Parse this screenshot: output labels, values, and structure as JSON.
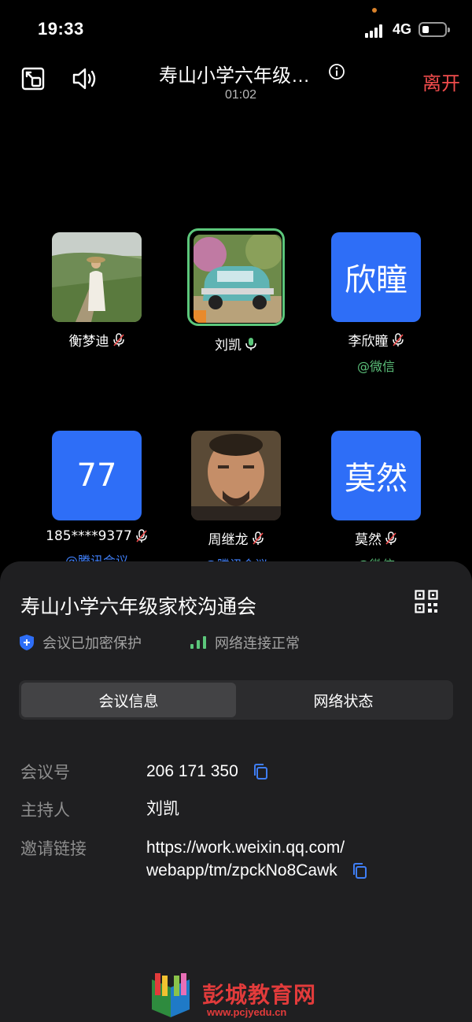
{
  "status_bar": {
    "time": "19:33",
    "network": "4G"
  },
  "header": {
    "title": "寿山小学六年级…",
    "elapsed": "01:02",
    "leave_label": "离开"
  },
  "participants": [
    {
      "name": "衡梦迪",
      "avatar_text": "",
      "source": "",
      "mic": "muted"
    },
    {
      "name": "刘凯",
      "avatar_text": "",
      "source": "",
      "mic": "on"
    },
    {
      "name": "李欣瞳",
      "avatar_text": "欣瞳",
      "source": "@微信",
      "mic": "muted"
    },
    {
      "name": "185****9377",
      "avatar_text": "77",
      "source": "@腾讯会议",
      "mic": "muted"
    },
    {
      "name": "周继龙",
      "avatar_text": "",
      "source": "@腾讯会议",
      "mic": "muted"
    },
    {
      "name": "莫然",
      "avatar_text": "莫然",
      "source": "@微信",
      "mic": "muted"
    }
  ],
  "sheet": {
    "title": "寿山小学六年级家校沟通会",
    "security_label": "会议已加密保护",
    "network_label": "网络连接正常",
    "tabs": [
      {
        "label": "会议信息",
        "selected": true
      },
      {
        "label": "网络状态",
        "selected": false
      }
    ],
    "meeting_id_label": "会议号",
    "meeting_id": "206 171 350",
    "host_label": "主持人",
    "host": "刘凯",
    "invite_label": "邀请链接",
    "invite_line1": "https://work.weixin.qq.com/",
    "invite_line2": "webapp/tm/zpckNo8Cawk"
  },
  "watermark": {
    "name": "彭城教育网",
    "url": "www.pcjyedu.cn"
  },
  "colors": {
    "accent_blue": "#2e6ef7",
    "leave_red": "#f04c4c",
    "wechat_green": "#5bbf79",
    "tencent_blue": "#3f7ef6",
    "speaking_green": "#5cc77b"
  }
}
